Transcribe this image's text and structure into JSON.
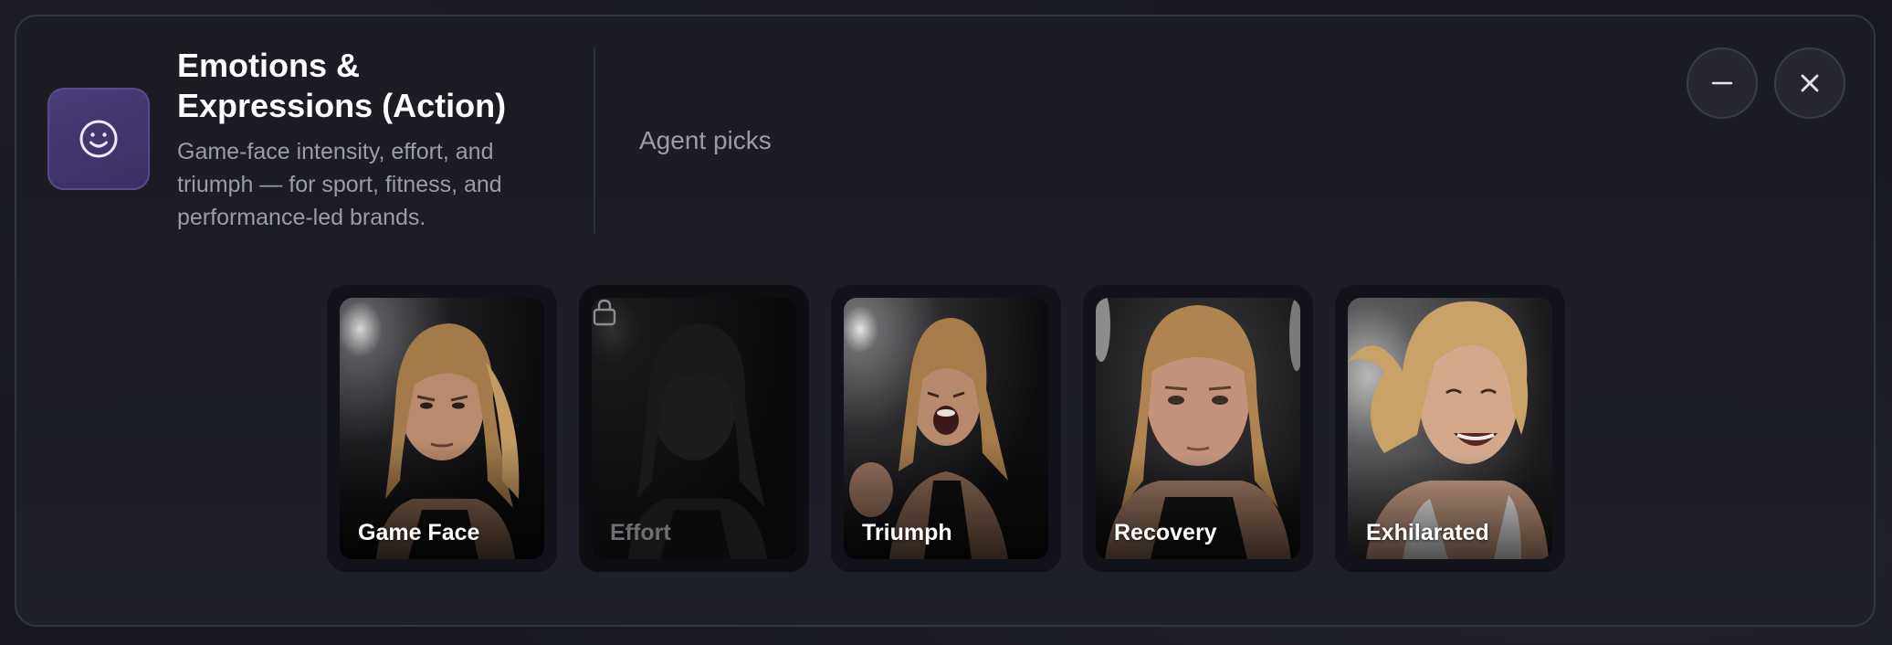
{
  "header": {
    "icon": "smiley-face-icon",
    "title": "Emotions & Expressions (Action)",
    "subtitle": "Game-face intensity, effort, and triumph — for sport, fitness, and performance-led brands.",
    "agent_picks_label": "Agent picks"
  },
  "controls": {
    "minimize_icon": "minus-icon",
    "close_icon": "close-icon"
  },
  "cards": [
    {
      "label": "Game Face",
      "locked": false,
      "image": "athlete-portrait-game-face"
    },
    {
      "label": "Effort",
      "locked": true,
      "image": "athlete-portrait-effort",
      "lock_icon": "lock-icon"
    },
    {
      "label": "Triumph",
      "locked": false,
      "image": "athlete-portrait-triumph"
    },
    {
      "label": "Recovery",
      "locked": false,
      "image": "athlete-portrait-recovery"
    },
    {
      "label": "Exhilarated",
      "locked": false,
      "image": "athlete-portrait-exhilarated"
    }
  ],
  "colors": {
    "accent_tile": "#4b3d78",
    "panel_border": "#33353f",
    "muted_text": "#9b9ca8",
    "title_text": "#ffffff"
  }
}
